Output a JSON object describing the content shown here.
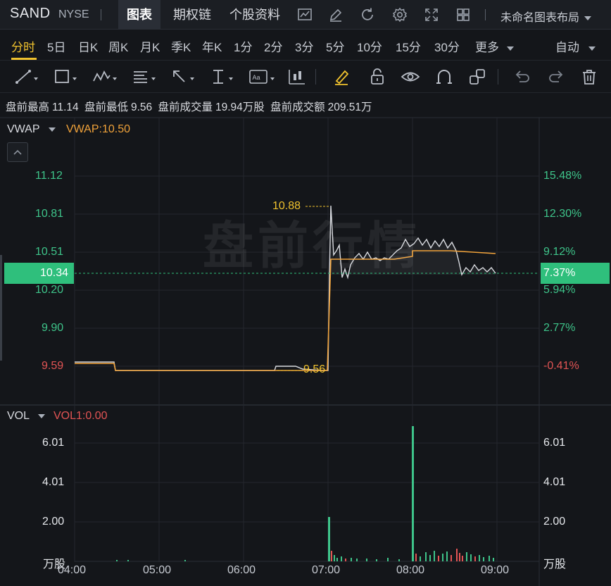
{
  "header": {
    "ticker": "SAND",
    "exchange": "NYSE",
    "tabs": [
      "图表",
      "期权链",
      "个股资料"
    ],
    "active_tab": "图表",
    "layout_name": "未命名图表布局"
  },
  "periods": {
    "items": [
      "分时",
      "5日",
      "日K",
      "周K",
      "月K",
      "季K",
      "年K",
      "1分",
      "2分",
      "3分",
      "5分",
      "10分",
      "15分",
      "30分",
      "更多"
    ],
    "active": "分时",
    "mode": "自动"
  },
  "info": {
    "premarket_high_label": "盘前最高",
    "premarket_high": "11.14",
    "premarket_low_label": "盘前最低",
    "premarket_low": "9.56",
    "premarket_volume_label": "盘前成交量",
    "premarket_volume": "19.94万股",
    "premarket_turnover_label": "盘前成交额",
    "premarket_turnover": "209.51万"
  },
  "price_panel": {
    "indicator": "VWAP",
    "indicator_value": "VWAP:10.50",
    "watermark": "盘前行情",
    "left_ticks": [
      "11.12",
      "10.81",
      "10.51",
      "10.20",
      "9.90",
      "9.59"
    ],
    "right_ticks": [
      "15.48%",
      "12.30%",
      "9.12%",
      "5.94%",
      "2.77%",
      "-0.41%"
    ],
    "current_price": "10.34",
    "current_pct": "7.37%",
    "high_marker": "10.88",
    "low_marker": "9.56"
  },
  "volume_panel": {
    "indicator": "VOL",
    "indicator_value": "VOL1:0.00",
    "left_ticks": [
      "6.01",
      "4.01",
      "2.00"
    ],
    "right_ticks": [
      "6.01",
      "4.01",
      "2.00"
    ],
    "unit": "万股"
  },
  "time_axis": [
    "04:00",
    "05:00",
    "06:00",
    "07:00",
    "08:00",
    "09:00"
  ],
  "colors": {
    "up": "#3ec48a",
    "down": "#e25454",
    "accent": "#f0c22e",
    "vwap": "#f0a23a"
  }
}
